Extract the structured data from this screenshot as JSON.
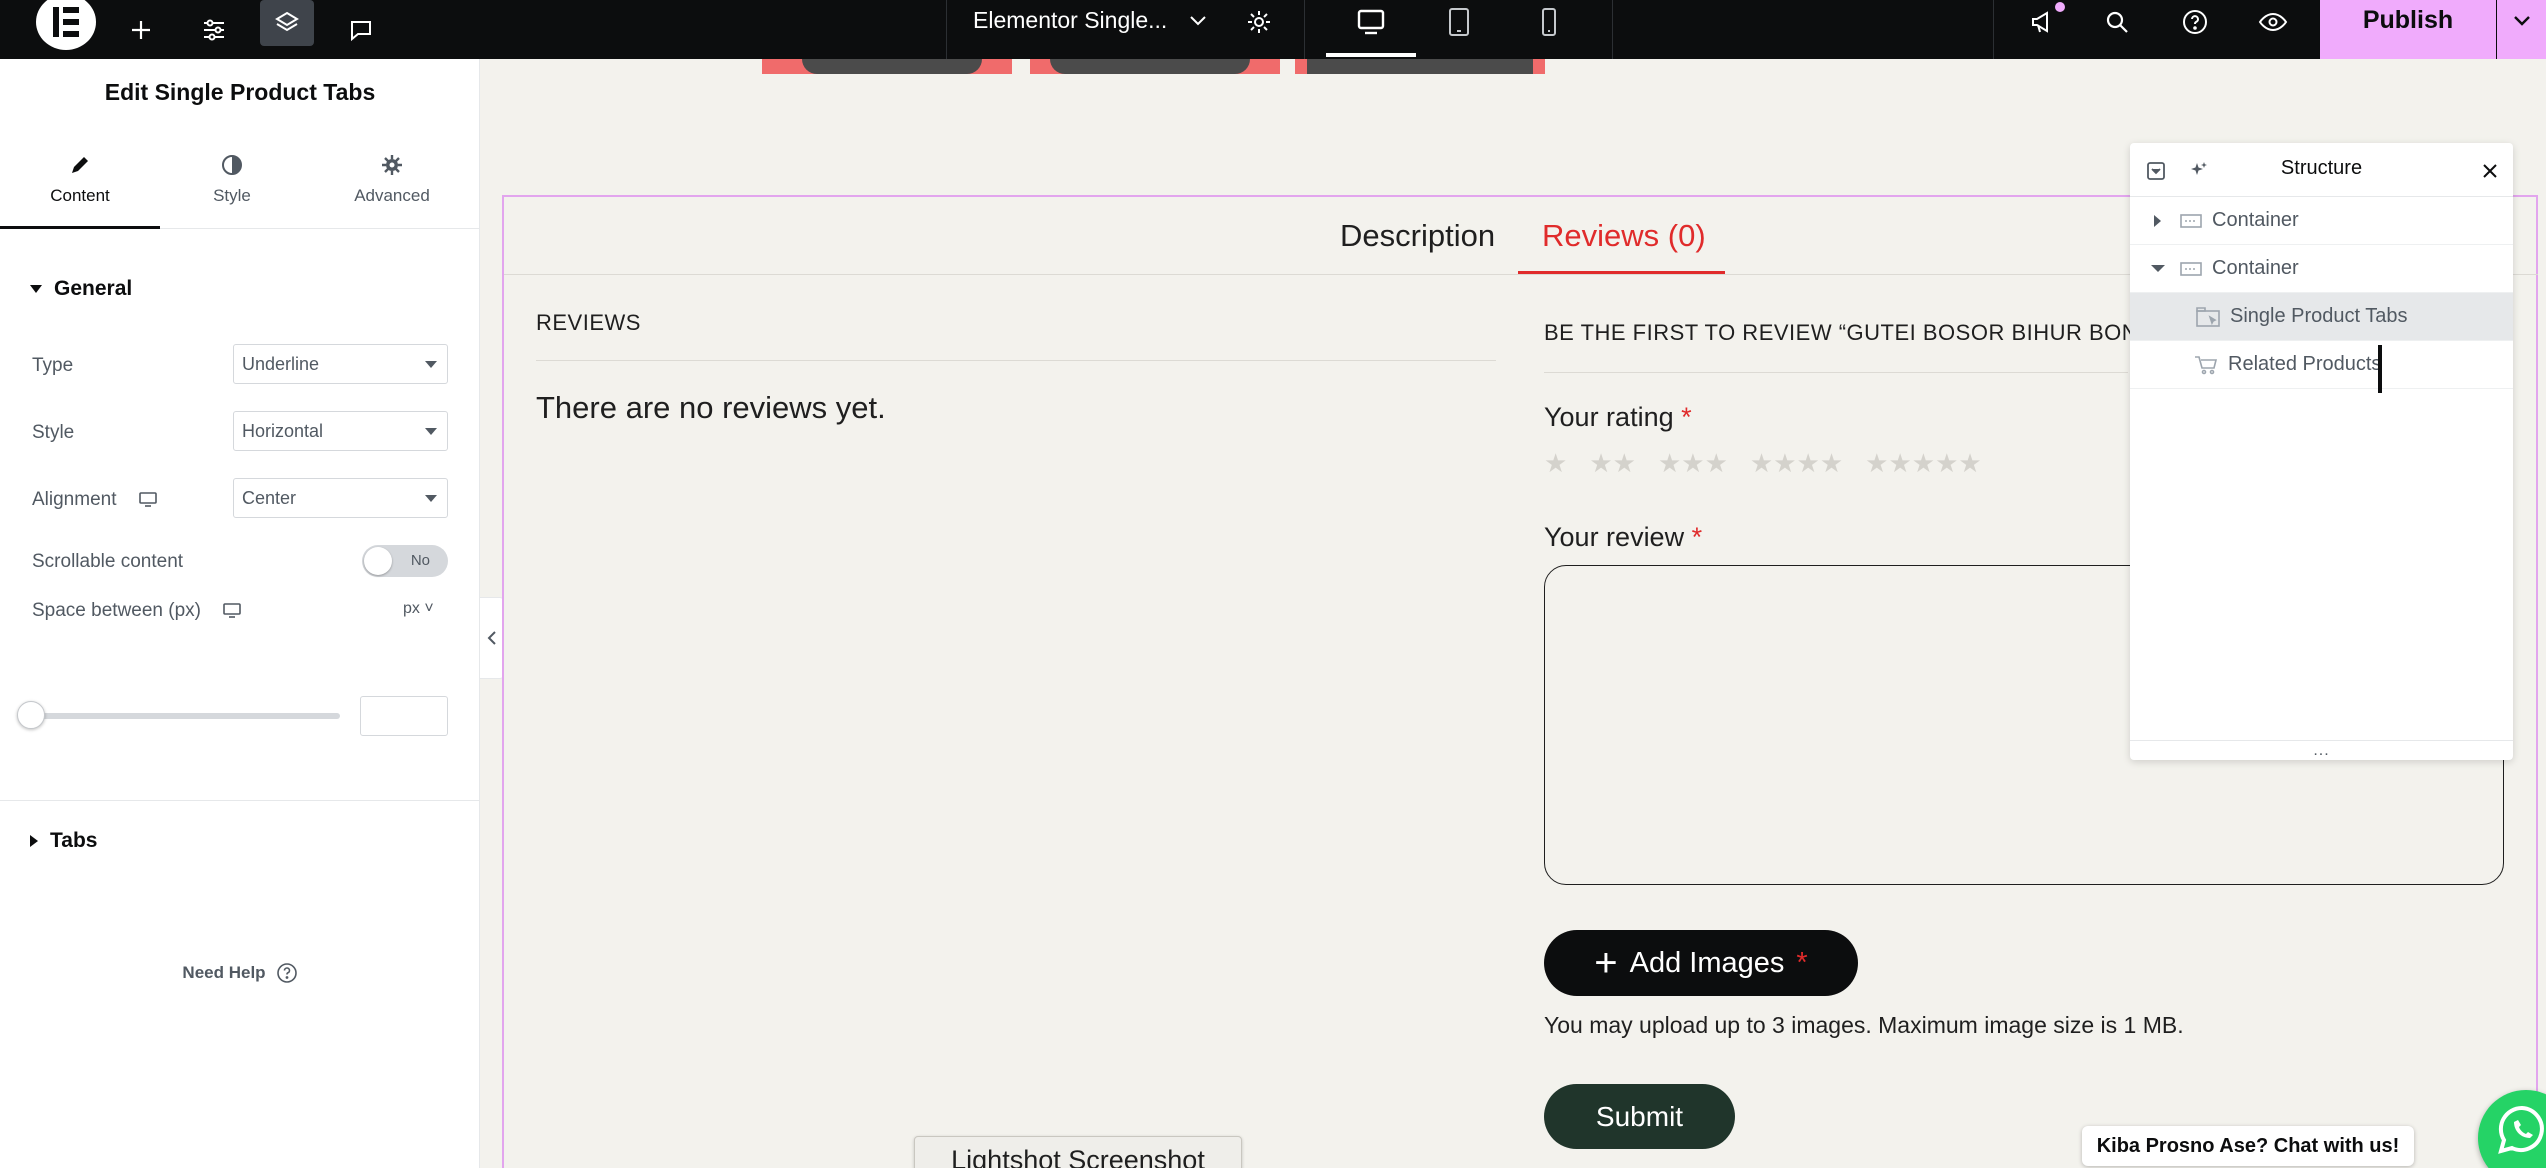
{
  "topbar": {
    "document_title": "Elementor Single...",
    "publish_label": "Publish",
    "icons": [
      "elementor-logo-icon",
      "plus-icon",
      "sliders-icon",
      "layers-icon",
      "comment-icon",
      "chevron-down-icon",
      "gear-icon",
      "desktop-icon",
      "tablet-icon",
      "mobile-icon",
      "megaphone-icon",
      "search-icon",
      "help-icon",
      "eye-icon"
    ]
  },
  "panel": {
    "title": "Edit Single Product Tabs",
    "tabs": [
      {
        "label": "Content",
        "icon": "pencil-icon",
        "active": true
      },
      {
        "label": "Style",
        "icon": "half-circle-icon",
        "active": false
      },
      {
        "label": "Advanced",
        "icon": "gear-icon",
        "active": false
      }
    ],
    "general_section": "General",
    "controls": {
      "type_label": "Type",
      "type_value": "Underline",
      "style_label": "Style",
      "style_value": "Horizontal",
      "alignment_label": "Alignment",
      "alignment_value": "Center",
      "scrollable_label": "Scrollable content",
      "scrollable_value": "No",
      "space_label": "Space between (px)",
      "space_unit": "px"
    },
    "tabs_section": "Tabs",
    "need_help": "Need Help"
  },
  "canvas": {
    "tabs": [
      "Description",
      "Reviews (0)"
    ],
    "active_tab": "Reviews (0)",
    "reviews_heading": "REVIEWS",
    "no_reviews": "There are no reviews yet.",
    "first_review_heading": "BE THE FIRST TO REVIEW “GUTEI BOSOR BIHUR BONI",
    "rating_label": "Your rating",
    "review_label": "Your review",
    "required_mark": "*",
    "add_images_label": "Add Images",
    "upload_note": "You may upload up to 3 images. Maximum image size is 1 MB.",
    "submit_label": "Submit",
    "accent_color": "#e02b2b"
  },
  "structure": {
    "title": "Structure",
    "items": [
      {
        "label": "Container",
        "expanded": false
      },
      {
        "label": "Container",
        "expanded": true
      },
      {
        "label": "Single Product Tabs",
        "selected": true
      },
      {
        "label": "Related Products"
      }
    ],
    "footer": "..."
  },
  "floating": {
    "lightshot_label": "Lightshot Screenshot",
    "chat_label": "Kiba Prosno Ase? Chat with us!"
  },
  "colors": {
    "topbar": "#0c0d0e",
    "publish": "#f0abfc",
    "canvas_bg": "#f3f2ed",
    "submit_bg": "#20352b",
    "frame_outline": "#e2a5ee"
  }
}
